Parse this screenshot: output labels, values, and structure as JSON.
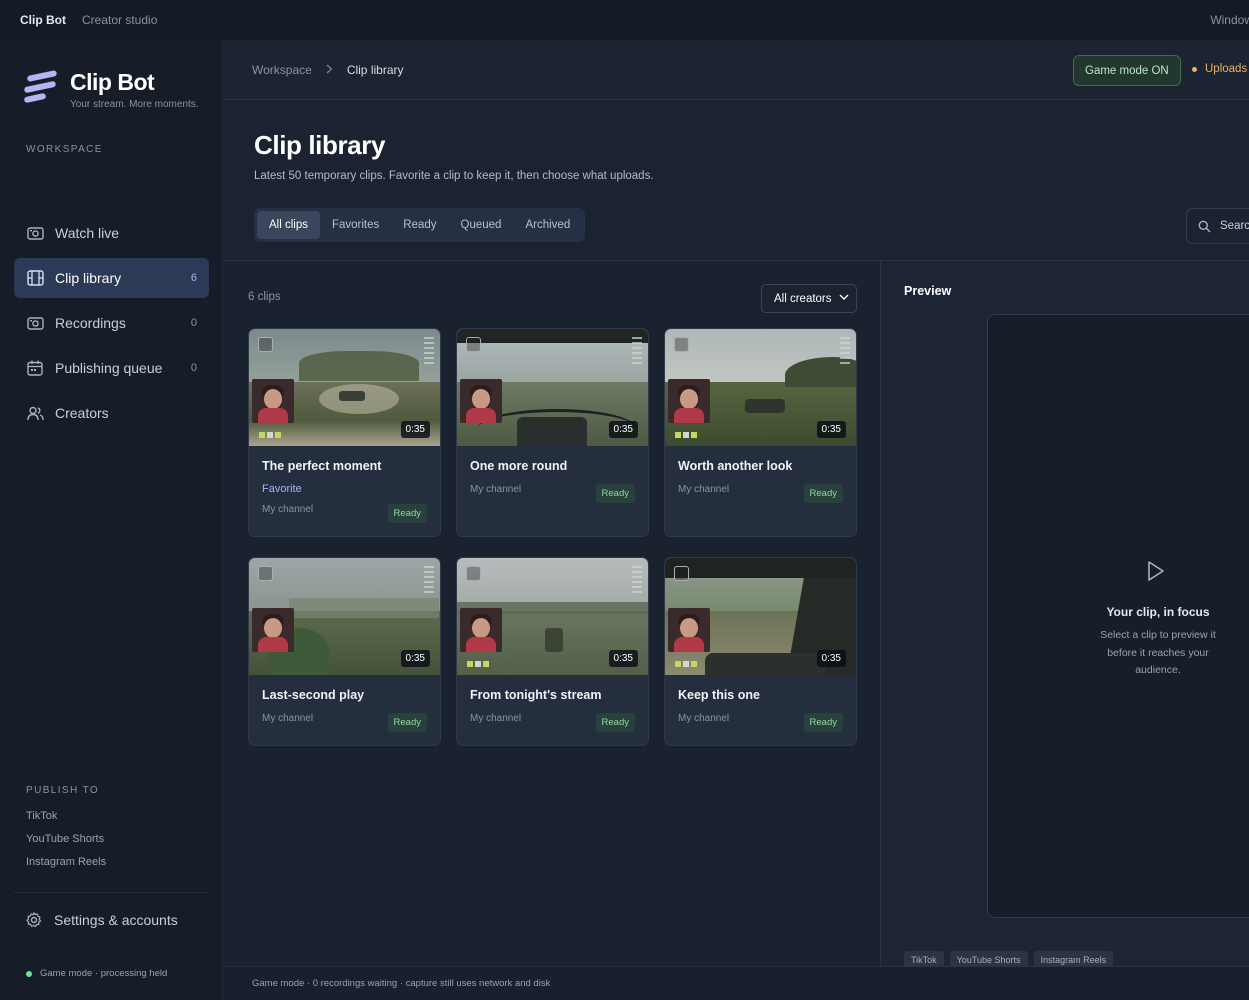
{
  "titlebar": {
    "app": "Clip Bot",
    "subtitle": "Creator studio",
    "window": "Window"
  },
  "brand": {
    "name": "Clip Bot",
    "tagline": "Your stream. More moments.",
    "accent": "#b8b3f5"
  },
  "sidebar": {
    "workspace_label": "WORKSPACE",
    "items": [
      {
        "label": "Watch live",
        "icon": "camera-icon",
        "count": ""
      },
      {
        "label": "Clip library",
        "icon": "film-icon",
        "count": "6",
        "active": true
      },
      {
        "label": "Recordings",
        "icon": "record-icon",
        "count": "0"
      },
      {
        "label": "Publishing queue",
        "icon": "calendar-icon",
        "count": "0"
      },
      {
        "label": "Creators",
        "icon": "users-icon",
        "count": ""
      }
    ],
    "publish_label": "PUBLISH TO",
    "publish": [
      "TikTok",
      "YouTube Shorts",
      "Instagram Reels"
    ],
    "settings": "Settings & accounts",
    "status": "Game mode · processing held"
  },
  "header": {
    "breadcrumb": [
      "Workspace",
      "Clip library"
    ],
    "game_mode": "Game mode ON",
    "uploads": "Uploads"
  },
  "page": {
    "title": "Clip library",
    "subtitle": "Latest 50 temporary clips. Favorite a clip to keep it, then choose what uploads.",
    "tabs": [
      "All clips",
      "Favorites",
      "Ready",
      "Queued",
      "Archived"
    ],
    "active_tab": "All clips",
    "search_placeholder": "Search"
  },
  "clips": {
    "count_label": "6 clips",
    "filter": "All creators",
    "items": [
      {
        "title": "The perfect moment",
        "favorite": "Favorite",
        "channel": "My channel",
        "status": "Ready",
        "duration": "0:35"
      },
      {
        "title": "One more round",
        "favorite": "",
        "channel": "My channel",
        "status": "Ready",
        "duration": "0:35"
      },
      {
        "title": "Worth another look",
        "favorite": "",
        "channel": "My channel",
        "status": "Ready",
        "duration": "0:35"
      },
      {
        "title": "Last-second play",
        "favorite": "",
        "channel": "My channel",
        "status": "Ready",
        "duration": "0:35"
      },
      {
        "title": "From tonight's stream",
        "favorite": "",
        "channel": "My channel",
        "status": "Ready",
        "duration": "0:35"
      },
      {
        "title": "Keep this one",
        "favorite": "",
        "channel": "My channel",
        "status": "Ready",
        "duration": "0:35"
      }
    ]
  },
  "preview": {
    "title": "Preview",
    "heading": "Your clip, in focus",
    "text": "Select a clip to preview it before it reaches your audience.",
    "tags": [
      "TikTok",
      "YouTube Shorts",
      "Instagram Reels"
    ]
  },
  "statusbar": {
    "text": "Game mode · 0 recordings waiting · capture still uses network and disk"
  }
}
